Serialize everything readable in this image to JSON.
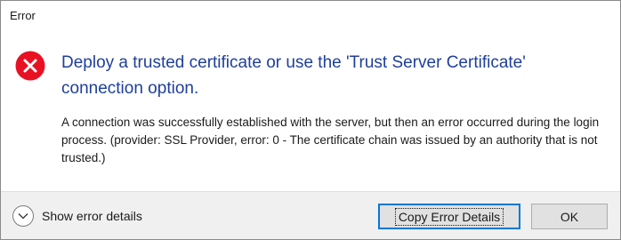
{
  "window": {
    "title": "Error"
  },
  "icon": {
    "name": "error-icon",
    "color": "#e81123"
  },
  "headline": "Deploy a trusted certificate or use the 'Trust Server Certificate' connection option.",
  "message": "A connection was successfully established with the server, but then an error occurred during the login process. (provider: SSL Provider, error: 0 - The certificate chain was issued by an authority that is not trusted.)",
  "footer": {
    "details_toggle_label": "Show error details",
    "details_icon": "chevron-down-icon",
    "copy_button_label": "Copy Error Details",
    "ok_button_label": "OK"
  },
  "colors": {
    "headline": "#1f3f9a",
    "focus_accent": "#0078d7"
  }
}
